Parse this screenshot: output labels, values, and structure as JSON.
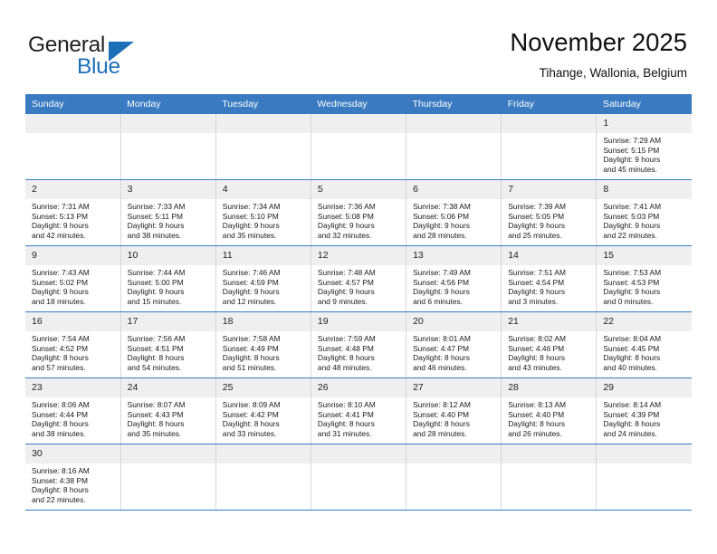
{
  "logo": {
    "word1": "General",
    "word2": "Blue",
    "triangle_color": "#1d6fb8"
  },
  "header": {
    "title": "November 2025",
    "subtitle": "Tihange, Wallonia, Belgium"
  },
  "theme": {
    "header_blue": "#3a7ac0",
    "day_band_gray": "#efefef",
    "row_divider": "#3a7ac0"
  },
  "weekday_headers": [
    "Sunday",
    "Monday",
    "Tuesday",
    "Wednesday",
    "Thursday",
    "Friday",
    "Saturday"
  ],
  "labels": {
    "sunrise_prefix": "Sunrise:",
    "sunset_prefix": "Sunset:",
    "daylight_prefix": "Daylight:"
  },
  "weeks": [
    [
      {
        "day": "",
        "blank": true
      },
      {
        "day": "",
        "blank": true
      },
      {
        "day": "",
        "blank": true
      },
      {
        "day": "",
        "blank": true
      },
      {
        "day": "",
        "blank": true
      },
      {
        "day": "",
        "blank": true
      },
      {
        "day": "1",
        "sunrise": "Sunrise: 7:29 AM",
        "sunset": "Sunset: 5:15 PM",
        "daylight1": "Daylight: 9 hours",
        "daylight2": "and 45 minutes."
      }
    ],
    [
      {
        "day": "2",
        "sunrise": "Sunrise: 7:31 AM",
        "sunset": "Sunset: 5:13 PM",
        "daylight1": "Daylight: 9 hours",
        "daylight2": "and 42 minutes."
      },
      {
        "day": "3",
        "sunrise": "Sunrise: 7:33 AM",
        "sunset": "Sunset: 5:11 PM",
        "daylight1": "Daylight: 9 hours",
        "daylight2": "and 38 minutes."
      },
      {
        "day": "4",
        "sunrise": "Sunrise: 7:34 AM",
        "sunset": "Sunset: 5:10 PM",
        "daylight1": "Daylight: 9 hours",
        "daylight2": "and 35 minutes."
      },
      {
        "day": "5",
        "sunrise": "Sunrise: 7:36 AM",
        "sunset": "Sunset: 5:08 PM",
        "daylight1": "Daylight: 9 hours",
        "daylight2": "and 32 minutes."
      },
      {
        "day": "6",
        "sunrise": "Sunrise: 7:38 AM",
        "sunset": "Sunset: 5:06 PM",
        "daylight1": "Daylight: 9 hours",
        "daylight2": "and 28 minutes."
      },
      {
        "day": "7",
        "sunrise": "Sunrise: 7:39 AM",
        "sunset": "Sunset: 5:05 PM",
        "daylight1": "Daylight: 9 hours",
        "daylight2": "and 25 minutes."
      },
      {
        "day": "8",
        "sunrise": "Sunrise: 7:41 AM",
        "sunset": "Sunset: 5:03 PM",
        "daylight1": "Daylight: 9 hours",
        "daylight2": "and 22 minutes."
      }
    ],
    [
      {
        "day": "9",
        "sunrise": "Sunrise: 7:43 AM",
        "sunset": "Sunset: 5:02 PM",
        "daylight1": "Daylight: 9 hours",
        "daylight2": "and 18 minutes."
      },
      {
        "day": "10",
        "sunrise": "Sunrise: 7:44 AM",
        "sunset": "Sunset: 5:00 PM",
        "daylight1": "Daylight: 9 hours",
        "daylight2": "and 15 minutes."
      },
      {
        "day": "11",
        "sunrise": "Sunrise: 7:46 AM",
        "sunset": "Sunset: 4:59 PM",
        "daylight1": "Daylight: 9 hours",
        "daylight2": "and 12 minutes."
      },
      {
        "day": "12",
        "sunrise": "Sunrise: 7:48 AM",
        "sunset": "Sunset: 4:57 PM",
        "daylight1": "Daylight: 9 hours",
        "daylight2": "and 9 minutes."
      },
      {
        "day": "13",
        "sunrise": "Sunrise: 7:49 AM",
        "sunset": "Sunset: 4:56 PM",
        "daylight1": "Daylight: 9 hours",
        "daylight2": "and 6 minutes."
      },
      {
        "day": "14",
        "sunrise": "Sunrise: 7:51 AM",
        "sunset": "Sunset: 4:54 PM",
        "daylight1": "Daylight: 9 hours",
        "daylight2": "and 3 minutes."
      },
      {
        "day": "15",
        "sunrise": "Sunrise: 7:53 AM",
        "sunset": "Sunset: 4:53 PM",
        "daylight1": "Daylight: 9 hours",
        "daylight2": "and 0 minutes."
      }
    ],
    [
      {
        "day": "16",
        "sunrise": "Sunrise: 7:54 AM",
        "sunset": "Sunset: 4:52 PM",
        "daylight1": "Daylight: 8 hours",
        "daylight2": "and 57 minutes."
      },
      {
        "day": "17",
        "sunrise": "Sunrise: 7:56 AM",
        "sunset": "Sunset: 4:51 PM",
        "daylight1": "Daylight: 8 hours",
        "daylight2": "and 54 minutes."
      },
      {
        "day": "18",
        "sunrise": "Sunrise: 7:58 AM",
        "sunset": "Sunset: 4:49 PM",
        "daylight1": "Daylight: 8 hours",
        "daylight2": "and 51 minutes."
      },
      {
        "day": "19",
        "sunrise": "Sunrise: 7:59 AM",
        "sunset": "Sunset: 4:48 PM",
        "daylight1": "Daylight: 8 hours",
        "daylight2": "and 48 minutes."
      },
      {
        "day": "20",
        "sunrise": "Sunrise: 8:01 AM",
        "sunset": "Sunset: 4:47 PM",
        "daylight1": "Daylight: 8 hours",
        "daylight2": "and 46 minutes."
      },
      {
        "day": "21",
        "sunrise": "Sunrise: 8:02 AM",
        "sunset": "Sunset: 4:46 PM",
        "daylight1": "Daylight: 8 hours",
        "daylight2": "and 43 minutes."
      },
      {
        "day": "22",
        "sunrise": "Sunrise: 8:04 AM",
        "sunset": "Sunset: 4:45 PM",
        "daylight1": "Daylight: 8 hours",
        "daylight2": "and 40 minutes."
      }
    ],
    [
      {
        "day": "23",
        "sunrise": "Sunrise: 8:06 AM",
        "sunset": "Sunset: 4:44 PM",
        "daylight1": "Daylight: 8 hours",
        "daylight2": "and 38 minutes."
      },
      {
        "day": "24",
        "sunrise": "Sunrise: 8:07 AM",
        "sunset": "Sunset: 4:43 PM",
        "daylight1": "Daylight: 8 hours",
        "daylight2": "and 35 minutes."
      },
      {
        "day": "25",
        "sunrise": "Sunrise: 8:09 AM",
        "sunset": "Sunset: 4:42 PM",
        "daylight1": "Daylight: 8 hours",
        "daylight2": "and 33 minutes."
      },
      {
        "day": "26",
        "sunrise": "Sunrise: 8:10 AM",
        "sunset": "Sunset: 4:41 PM",
        "daylight1": "Daylight: 8 hours",
        "daylight2": "and 31 minutes."
      },
      {
        "day": "27",
        "sunrise": "Sunrise: 8:12 AM",
        "sunset": "Sunset: 4:40 PM",
        "daylight1": "Daylight: 8 hours",
        "daylight2": "and 28 minutes."
      },
      {
        "day": "28",
        "sunrise": "Sunrise: 8:13 AM",
        "sunset": "Sunset: 4:40 PM",
        "daylight1": "Daylight: 8 hours",
        "daylight2": "and 26 minutes."
      },
      {
        "day": "29",
        "sunrise": "Sunrise: 8:14 AM",
        "sunset": "Sunset: 4:39 PM",
        "daylight1": "Daylight: 8 hours",
        "daylight2": "and 24 minutes."
      }
    ],
    [
      {
        "day": "30",
        "sunrise": "Sunrise: 8:16 AM",
        "sunset": "Sunset: 4:38 PM",
        "daylight1": "Daylight: 8 hours",
        "daylight2": "and 22 minutes."
      },
      {
        "day": "",
        "blank": true
      },
      {
        "day": "",
        "blank": true
      },
      {
        "day": "",
        "blank": true
      },
      {
        "day": "",
        "blank": true
      },
      {
        "day": "",
        "blank": true
      },
      {
        "day": "",
        "blank": true
      }
    ]
  ]
}
